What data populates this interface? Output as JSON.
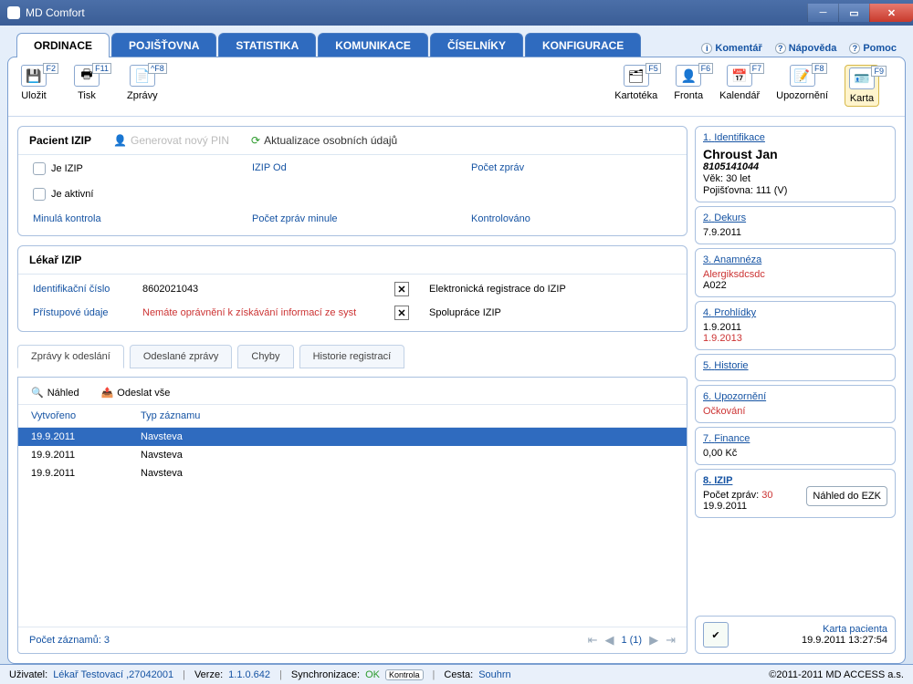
{
  "window": {
    "title": "MD Comfort"
  },
  "tabs": {
    "ordinace": "ORDINACE",
    "pojistovna": "POJIŠŤOVNA",
    "statistika": "STATISTIKA",
    "komunikace": "KOMUNIKACE",
    "ciselniky": "ČÍSELNÍKY",
    "konfigurace": "KONFIGURACE"
  },
  "help": {
    "komentar": "Komentář",
    "napoveda": "Nápověda",
    "pomoc": "Pomoc"
  },
  "toolbar": {
    "ulozit": {
      "label": "Uložit",
      "fkey": "F2"
    },
    "tisk": {
      "label": "Tisk",
      "fkey": "F11"
    },
    "zpravy": {
      "label": "Zprávy",
      "fkey": "^F8"
    },
    "kartoteka": {
      "label": "Kartotéka",
      "fkey": "F5"
    },
    "fronta": {
      "label": "Fronta",
      "fkey": "F6"
    },
    "kalendar": {
      "label": "Kalendář",
      "fkey": "F7"
    },
    "upozorneni": {
      "label": "Upozornění",
      "fkey": "F8"
    },
    "karta": {
      "label": "Karta",
      "fkey": "F9"
    }
  },
  "pacient_panel": {
    "title": "Pacient IZIP",
    "gen_pin": "Generovat nový PIN",
    "aktualizace": "Aktualizace osobních údajů",
    "je_izip": "Je IZIP",
    "izip_od": "IZIP Od",
    "pocet_zprav": "Počet zpráv",
    "je_aktivni": "Je aktivní",
    "minula_kontrola": "Minulá kontrola",
    "pocet_zprav_minule": "Počet zpráv minule",
    "kontrolovano": "Kontrolováno"
  },
  "lekar_panel": {
    "title": "Lékař IZIP",
    "id_label": "Identifikační číslo",
    "id_value": "8602021043",
    "pristup_label": "Přístupové údaje",
    "pristup_value": "Nemáte oprávnění k získávání informací ze syst",
    "ereg": "Elektronická registrace do IZIP",
    "spoluprace": "Spolupráce IZIP"
  },
  "subtabs": {
    "odeslani": "Zprávy k odeslání",
    "odeslane": "Odeslané zprávy",
    "chyby": "Chyby",
    "historie": "Historie registrací"
  },
  "list": {
    "nahled": "Náhled",
    "odeslat": "Odeslat vše",
    "col_vytvoreno": "Vytvořeno",
    "col_typ": "Typ záznamu",
    "rows": [
      {
        "d": "19.9.2011",
        "t": "Navsteva"
      },
      {
        "d": "19.9.2011",
        "t": "Navsteva"
      },
      {
        "d": "19.9.2011",
        "t": "Navsteva"
      }
    ],
    "count_label": "Počet záznamů: 3",
    "pager": "1 (1)"
  },
  "side": {
    "ident": {
      "num": "1.",
      "title": "Identifikace",
      "name": "Chroust Jan",
      "rc": "8105141044",
      "vek": "Věk: 30 let",
      "pojistovna": "Pojišťovna: 111 (V)"
    },
    "dekurs": {
      "num": "2.",
      "title": "Dekurs",
      "val": "7.9.2011"
    },
    "anamneza": {
      "num": "3.",
      "title": "Anamnéza",
      "val1": "Alergiksdcsdc",
      "val2": "A022"
    },
    "prohlidky": {
      "num": "4.",
      "title": "Prohlídky",
      "val1": "1.9.2011",
      "val2": "1.9.2013"
    },
    "historie": {
      "num": "5.",
      "title": "Historie"
    },
    "upozorneni": {
      "num": "6.",
      "title": "Upozornění",
      "val": "Očkování"
    },
    "finance": {
      "num": "7.",
      "title": "Finance",
      "val": "0,00 Kč"
    },
    "izip": {
      "num": "8.",
      "title": "IZIP",
      "pocet_label": "Počet zpráv:",
      "pocet_val": "30",
      "date": "19.9.2011",
      "btn": "Náhled do EZK"
    },
    "footer": {
      "l1": "Karta pacienta",
      "l2": "19.9.2011 13:27:54"
    }
  },
  "status": {
    "uzivatel_label": "Uživatel:",
    "uzivatel_val": "Lékař Testovací ,27042001",
    "verze_label": "Verze:",
    "verze_val": "1.1.0.642",
    "sync_label": "Synchronizace:",
    "sync_val": "OK",
    "kontrola": "Kontrola",
    "cesta_label": "Cesta:",
    "cesta_val": "Souhrn",
    "copyright": "©2011-2011 MD ACCESS a.s."
  }
}
